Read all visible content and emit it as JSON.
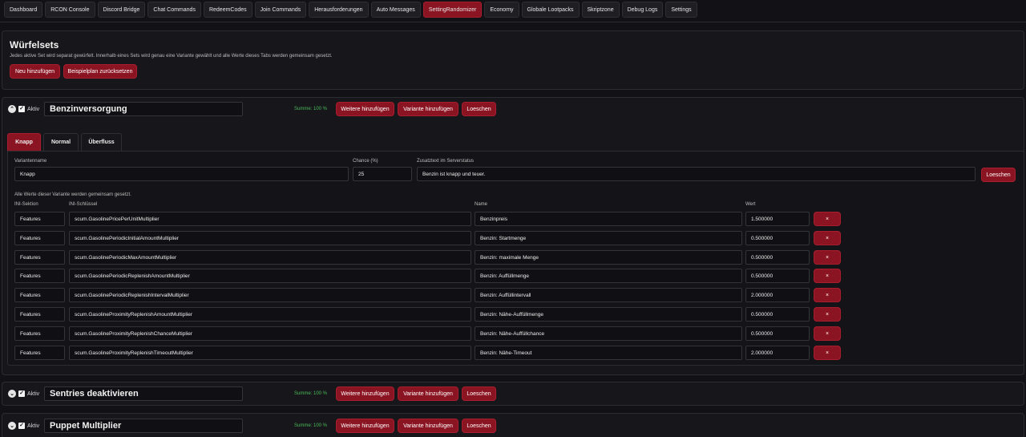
{
  "nav": {
    "tabs": [
      {
        "label": "Dashboard",
        "active": false
      },
      {
        "label": "RCON Console",
        "active": false
      },
      {
        "label": "Discord Bridge",
        "active": false
      },
      {
        "label": "Chat Commands",
        "active": false
      },
      {
        "label": "RedeemCodes",
        "active": false
      },
      {
        "label": "Join Commands",
        "active": false
      },
      {
        "label": "Herausforderungen",
        "active": false
      },
      {
        "label": "Auto Messages",
        "active": false
      },
      {
        "label": "SettingRandomizer",
        "active": true
      },
      {
        "label": "Economy",
        "active": false
      },
      {
        "label": "Globale Lootpacks",
        "active": false
      },
      {
        "label": "Skriptzone",
        "active": false
      },
      {
        "label": "Debug Logs",
        "active": false
      },
      {
        "label": "Settings",
        "active": false
      }
    ]
  },
  "header": {
    "title": "Würfelsets",
    "subtitle": "Jedes aktive Set wird separat gewürfelt. Innerhalb eines Sets wird genau eine Variante gewählt und alle Werte dieses Tabs werden gemeinsam gesetzt.",
    "add_label": "Neu hinzufügen",
    "reset_label": "Beispielplan zurücksetzen"
  },
  "common": {
    "aktiv_label": "Aktiv",
    "weitere_label": "Weitere hinzufügen",
    "variante_label": "Variante hinzufügen",
    "loeschen_label": "Loeschen",
    "remove_label": "×",
    "check_mark": "✓",
    "collapse_up": "⌃",
    "collapse_down": "⌄"
  },
  "sets": [
    {
      "name": "Benzinversorgung",
      "summe": "Summe: 100 %",
      "expanded": true
    },
    {
      "name": "Sentries deaktivieren",
      "summe": "Summe: 100 %",
      "expanded": false
    },
    {
      "name": "Puppet Multiplier",
      "summe": "Summe: 100 %",
      "expanded": false
    }
  ],
  "variant_tabs": [
    {
      "label": "Knapp",
      "active": true
    },
    {
      "label": "Normal",
      "active": false
    },
    {
      "label": "Überfluss",
      "active": false
    }
  ],
  "variant": {
    "name_label": "Variantenname",
    "name_value": "Knapp",
    "chance_label": "Chance (%)",
    "chance_value": "25",
    "zusatz_label": "Zusatztext im Serverstatus",
    "zusatz_value": "Benzin ist knapp und teuer.",
    "note": "Alle Werte dieser Variante werden gemeinsam gesetzt.",
    "columns": {
      "section": "INI-Sektion",
      "key": "INI-Schlüssel",
      "name": "Name",
      "value": "Wert"
    },
    "rows": [
      {
        "section": "Features",
        "key": "scum.GasolinePricePerUnitMultiplier",
        "name": "Benzinpreis",
        "value": "1.500000"
      },
      {
        "section": "Features",
        "key": "scum.GasolinePeriodicInitialAmountMultiplier",
        "name": "Benzin: Startmenge",
        "value": "0.500000"
      },
      {
        "section": "Features",
        "key": "scum.GasolinePeriodicMaxAmountMultiplier",
        "name": "Benzin: maximale Menge",
        "value": "0.500000"
      },
      {
        "section": "Features",
        "key": "scum.GasolinePeriodicReplenishAmountMultiplier",
        "name": "Benzin: Auffüllmenge",
        "value": "0.500000"
      },
      {
        "section": "Features",
        "key": "scum.GasolinePeriodicReplenishIntervalMultiplier",
        "name": "Benzin: Auffüllintervall",
        "value": "2.000000"
      },
      {
        "section": "Features",
        "key": "scum.GasolineProximityReplenishAmountMultiplier",
        "name": "Benzin: Nähe-Auffüllmenge",
        "value": "0.500000"
      },
      {
        "section": "Features",
        "key": "scum.GasolineProximityReplenishChanceMultiplier",
        "name": "Benzin: Nähe-Auffüllchance",
        "value": "0.500000"
      },
      {
        "section": "Features",
        "key": "scum.GasolineProximityReplenishTimeoutMultiplier",
        "name": "Benzin: Nähe-Timeout",
        "value": "2.000000"
      }
    ]
  }
}
